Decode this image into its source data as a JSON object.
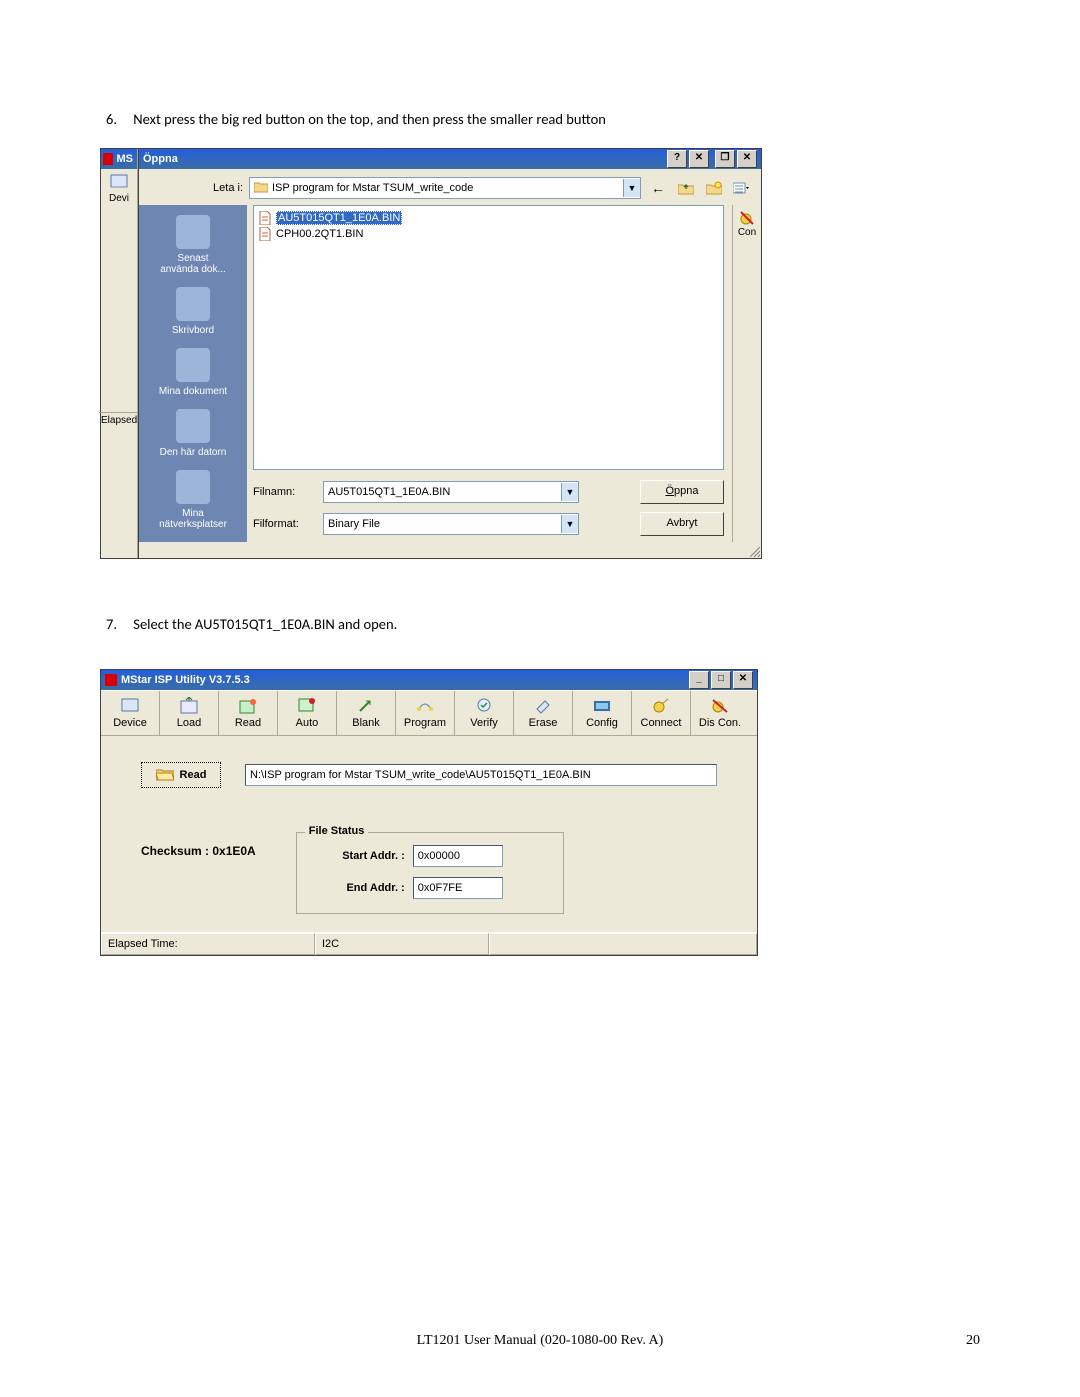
{
  "doc": {
    "instr6_num": "6.",
    "instr6": "Next press the big red button on the top, and then press the smaller read button",
    "instr7_num": "7.",
    "instr7": "Select the AU5T015QT1_1E0A.BIN and open.",
    "footer": "LT1201 User Manual (020-1080-00 Rev. A)",
    "page": "20"
  },
  "main": {
    "left_label_top": "MS",
    "left_label_devi": "Devi",
    "left_label_elapsed": "Elapsed",
    "right_label_con": "Con"
  },
  "open": {
    "title": "Öppna",
    "lookin_label": "Leta i:",
    "lookin_value": "ISP program for Mstar TSUM_write_code",
    "places": [
      "Senast\nanvända dok...",
      "Skrivbord",
      "Mina dokument",
      "Den här datorn",
      "Mina\nnätverksplatser"
    ],
    "files": [
      "AU5T015QT1_1E0A.BIN",
      "CPH00.2QT1.BIN"
    ],
    "filename_label": "Filnamn:",
    "filename_value": "AU5T015QT1_1E0A.BIN",
    "filetype_label": "Filformat:",
    "filetype_value": "Binary File",
    "btn_open": "Öppna",
    "btn_cancel": "Avbryt"
  },
  "isp": {
    "title": "MStar ISP Utility V3.7.5.3",
    "toolbar": [
      "Device",
      "Load",
      "Read",
      "Auto",
      "Blank",
      "Program",
      "Verify",
      "Erase",
      "Config",
      "Connect",
      "Dis Con."
    ],
    "read_btn": "Read",
    "path": "N:\\ISP program for Mstar TSUM_write_code\\AU5T015QT1_1E0A.BIN",
    "checksum": "Checksum : 0x1E0A",
    "file_status": "File Status",
    "start_label": "Start Addr. :",
    "start_value": "0x00000",
    "end_label": "End Addr. :",
    "end_value": "0x0F7FE",
    "status_elapsed": "Elapsed Time:",
    "status_mode": "I2C"
  }
}
